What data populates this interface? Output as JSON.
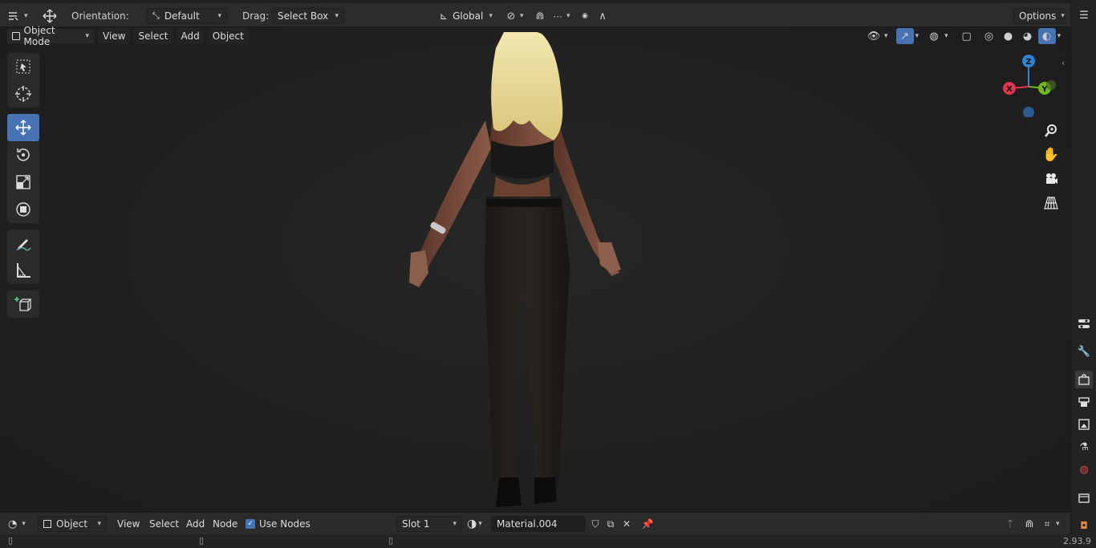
{
  "header": {
    "orientation_label": "Orientation:",
    "orientation_value": "Default",
    "drag_label": "Drag:",
    "drag_value": "Select Box",
    "transform_space": "Global",
    "options_label": "Options"
  },
  "viewport_header": {
    "mode": "Object Mode",
    "menus": [
      "View",
      "Select",
      "Add",
      "Object"
    ]
  },
  "gizmo": {
    "z": "Z",
    "y": "Y",
    "x": "X"
  },
  "bottom_header": {
    "editor_type": "Object",
    "menus": [
      "View",
      "Select",
      "Add",
      "Node"
    ],
    "use_nodes_label": "Use Nodes",
    "use_nodes_checked": true,
    "slot": "Slot 1",
    "material": "Material.004"
  },
  "status": {
    "version": "2.93.9"
  },
  "colors": {
    "accent": "#4772b3",
    "axis_x": "#e0344f",
    "axis_y": "#6fb61f",
    "axis_z": "#2f83d3"
  }
}
